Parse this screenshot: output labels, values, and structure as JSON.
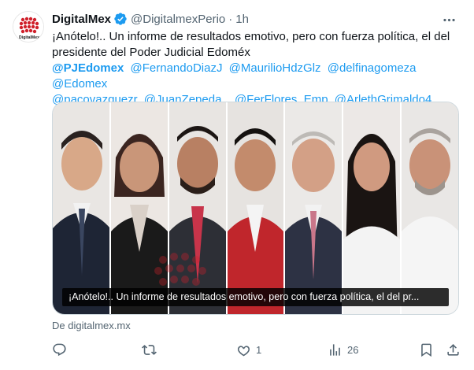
{
  "tweet": {
    "author_name": "DigitalMex",
    "handle": "@DigitalmexPerio",
    "separator": "·",
    "time": "1h",
    "text": "¡Anótelo!.. Un informe de resultados emotivo, pero con fuerza política, el del presidente del Poder Judicial Edoméx",
    "mentions": [
      "@PJEdomex",
      "@FernandoDiazJ",
      "@MaurilioHdzGlz",
      "@delfinagomeza",
      "@Edomex",
      "@pacovazquezr",
      "@JuanZepeda_",
      "@FerFlores_Emp",
      "@ArlethGrimaldo4"
    ],
    "media_caption": "¡Anótelo!.. Un informe de resultados emotivo, pero con fuerza política, el del pr...",
    "source": "De digitalmex.mx",
    "avatar_text": "DigitalMex"
  },
  "actions": {
    "reply_count": "",
    "retweet_count": "",
    "like_count": "1",
    "views_count": "26"
  },
  "colors": {
    "link": "#1d9bf0",
    "secondary_text": "#536471",
    "brand_red": "#d0202b"
  },
  "icons": [
    "verified-badge-icon",
    "more-icon",
    "reply-icon",
    "retweet-icon",
    "like-icon",
    "views-icon",
    "bookmark-icon",
    "share-icon"
  ]
}
